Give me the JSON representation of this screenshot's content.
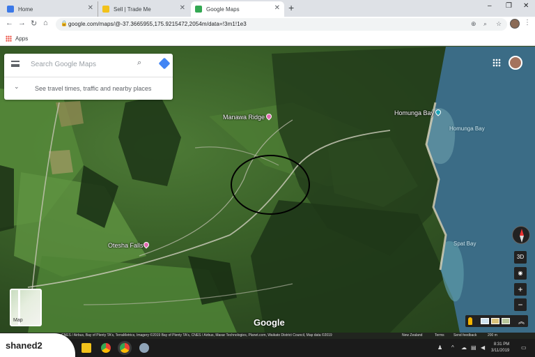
{
  "browser": {
    "tabs": [
      {
        "title": "Home",
        "favicon_color": "#3b78e7"
      },
      {
        "title": "Sell | Trade Me",
        "favicon_color": "#f2c21b"
      },
      {
        "title": "Google Maps",
        "favicon_color": "#34a853",
        "active": true
      }
    ],
    "new_tab_glyph": "+",
    "window_controls": {
      "minimize": "–",
      "maximize": "❐",
      "close": "✕"
    },
    "url": "google.com/maps/@-37.3665955,175.9215472,2054m/data=!3m1!1e3",
    "bookmarks_bar": {
      "apps_label": "Apps"
    }
  },
  "search": {
    "placeholder": "Search Google Maps",
    "travel_hint": "See travel times, traffic and nearby places"
  },
  "map": {
    "places": [
      {
        "name": "Manawa Ridge",
        "pin_color": "#e26ab0"
      },
      {
        "name": "Otesha Falls",
        "pin_color": "#e26ab0"
      },
      {
        "name": "Homunga Bay",
        "pin_color": "#1aa3b8"
      }
    ],
    "water_labels": [
      "Homunga Bay",
      "Spat Bay"
    ],
    "controls": {
      "tilt": "3D",
      "zoom_in": "+",
      "zoom_out": "−"
    },
    "thumbnail_label": "Map",
    "logo": "Google",
    "attribution": {
      "imagery": "CNES / Airbus, Bay of Plenty TA's, TerraMetrics, Imagery ©2019 Bay of Plenty TA's, CNES / Airbus, Maxar Technologies, Planet.com, Waikato District Council, Map data ©2019",
      "country": "New Zealand",
      "terms": "Terms",
      "feedback": "Send feedback",
      "scale": "200 m"
    }
  },
  "taskbar": {
    "time": "8:31 PM",
    "date": "3/11/2019"
  },
  "watermark": "shaned2"
}
